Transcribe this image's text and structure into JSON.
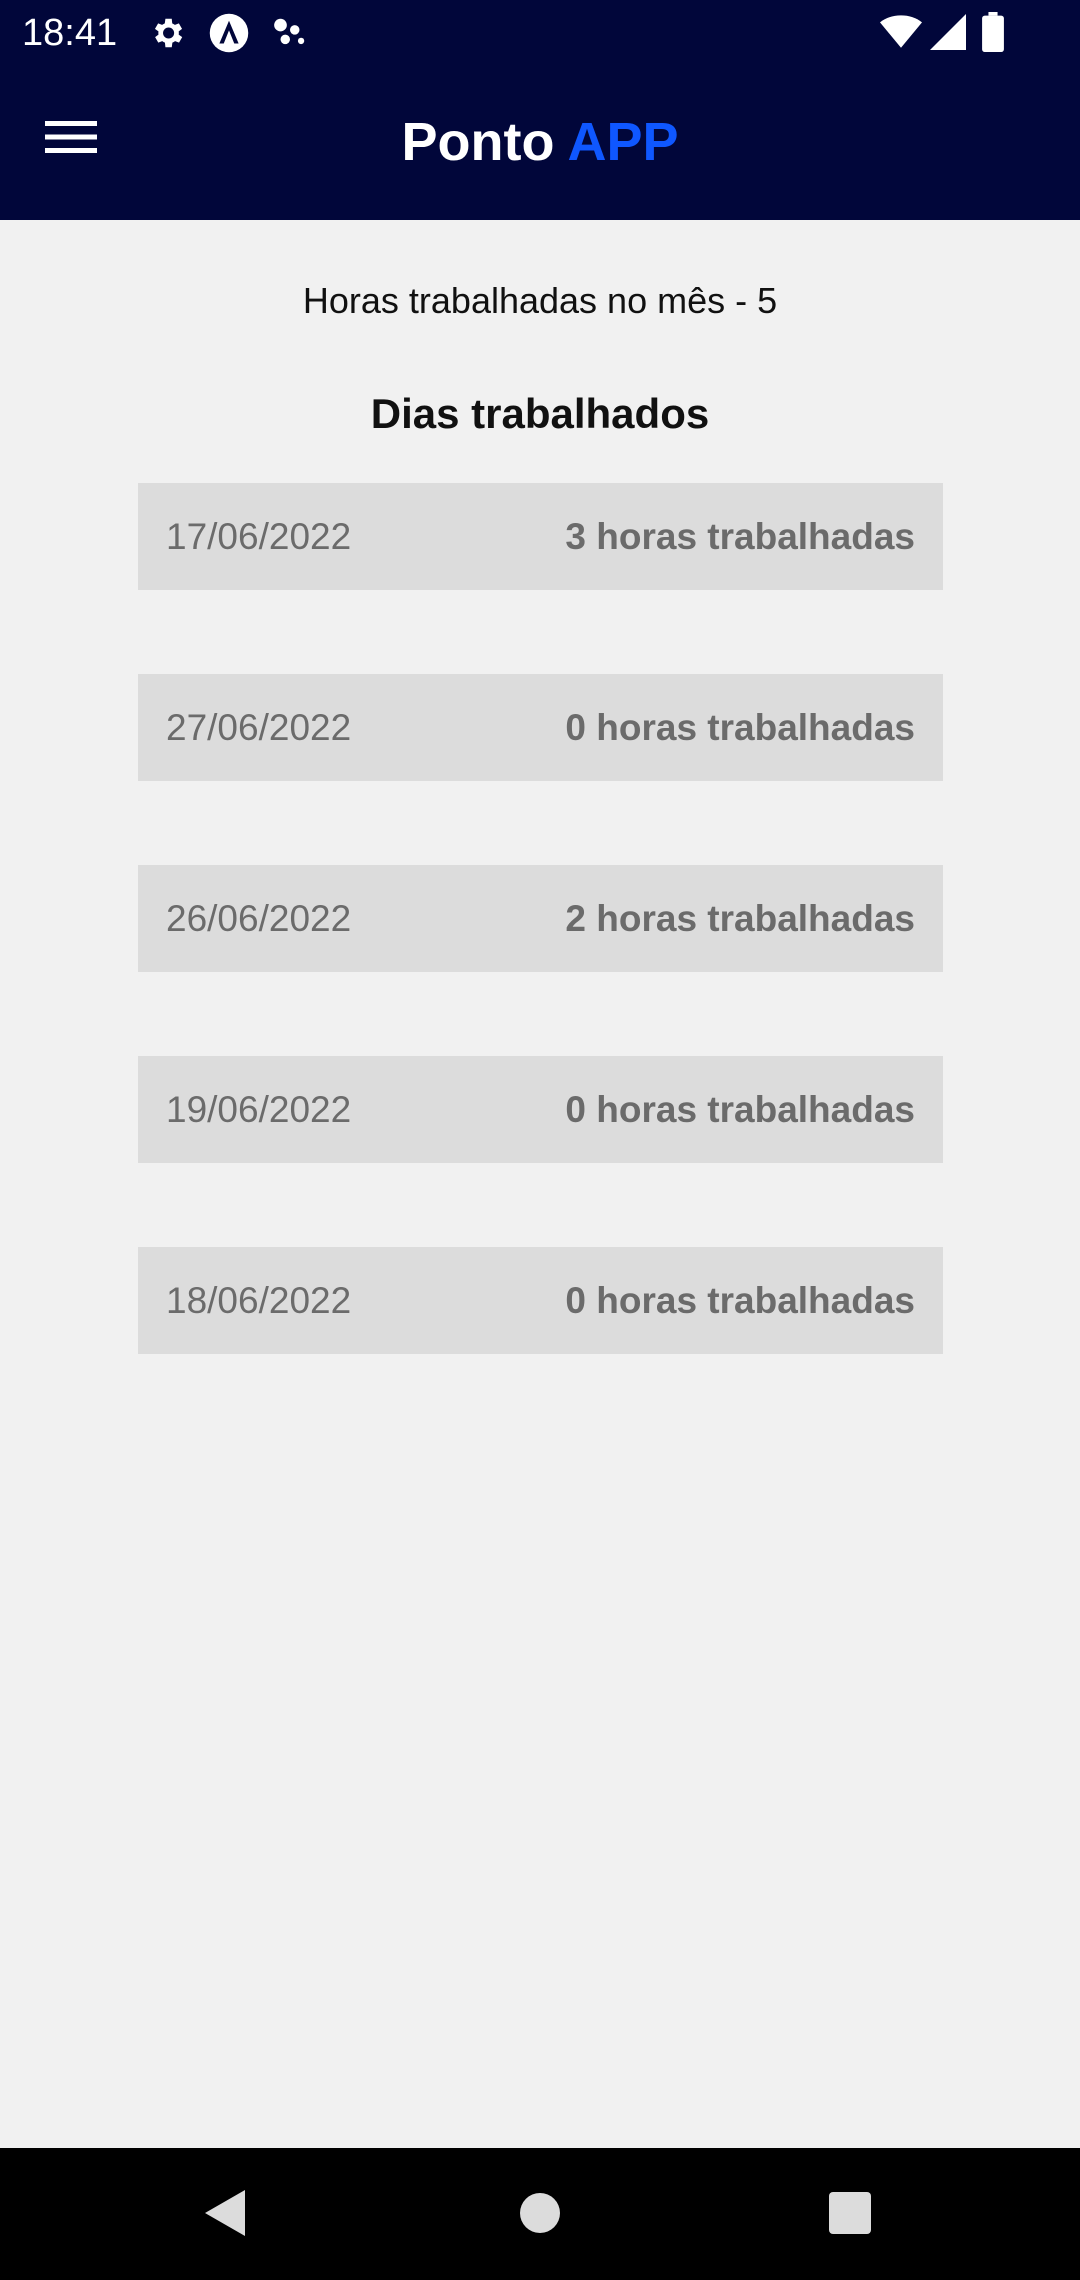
{
  "status_bar": {
    "time": "18:41",
    "icons": [
      "settings-icon",
      "app-notification-icon",
      "dots-icon",
      "wifi-icon",
      "cell-signal-icon",
      "battery-icon"
    ]
  },
  "app_bar": {
    "title_main": "Ponto",
    "title_accent": "APP",
    "menu_icon": "hamburger-menu-icon",
    "background_color": "#01063a",
    "accent_color": "#0f57ff"
  },
  "main": {
    "month_hours": "Horas trabalhadas no mês - 5",
    "section_title": "Dias trabalhados",
    "days": [
      {
        "date": "17/06/2022",
        "hours": "3 horas trabalhadas"
      },
      {
        "date": "27/06/2022",
        "hours": "0 horas trabalhadas"
      },
      {
        "date": "26/06/2022",
        "hours": "2 horas trabalhadas"
      },
      {
        "date": "19/06/2022",
        "hours": "0 horas trabalhadas"
      },
      {
        "date": "18/06/2022",
        "hours": "0 horas trabalhadas"
      }
    ]
  },
  "nav_bar": {
    "buttons": [
      "back-icon",
      "home-icon",
      "recents-icon"
    ]
  }
}
